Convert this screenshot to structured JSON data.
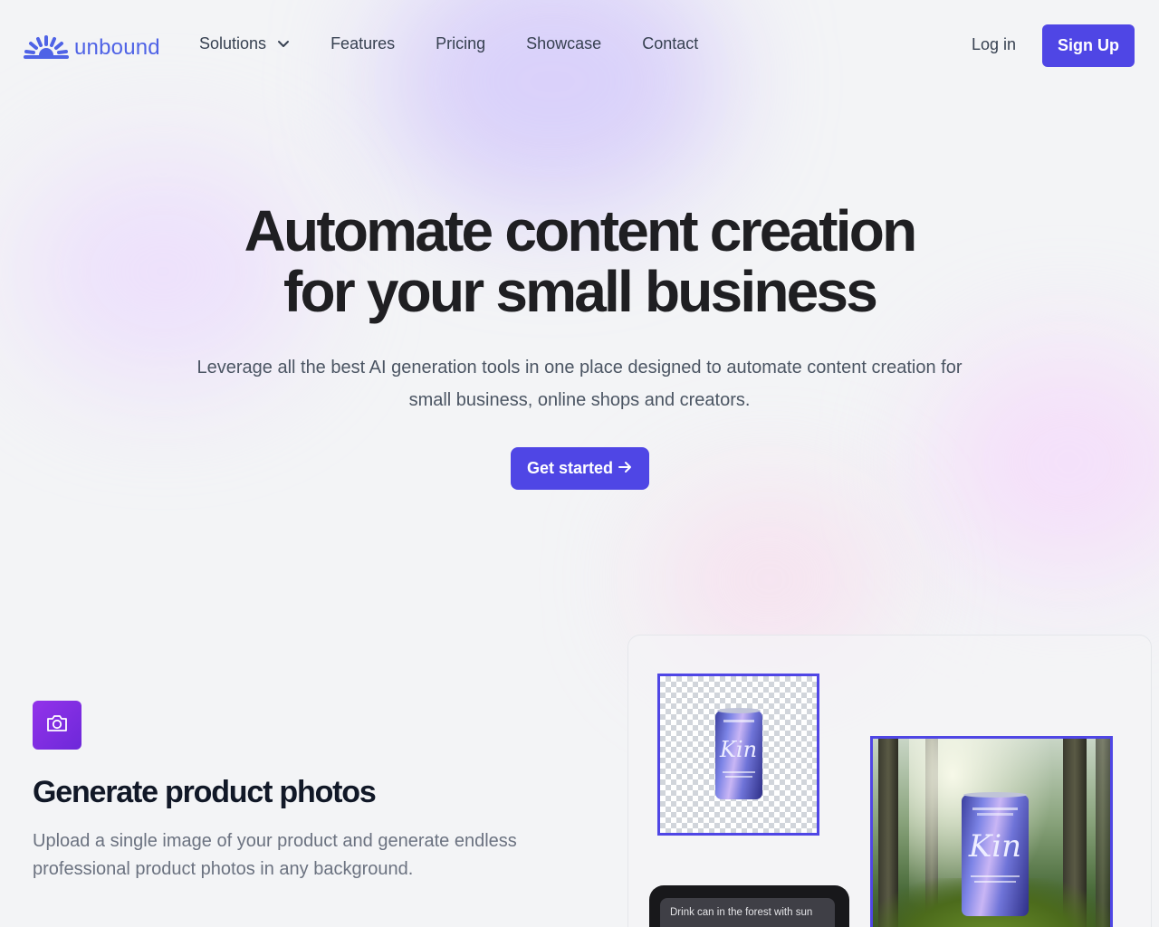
{
  "header": {
    "logo_text": "unbound",
    "nav": [
      {
        "label": "Solutions",
        "has_dropdown": true
      },
      {
        "label": "Features"
      },
      {
        "label": "Pricing"
      },
      {
        "label": "Showcase"
      },
      {
        "label": "Contact"
      }
    ],
    "login_label": "Log in",
    "signup_label": "Sign Up"
  },
  "hero": {
    "title_line1": "Automate content creation",
    "title_line2": "for your small business",
    "subtitle_line1": "Leverage all the best AI generation tools in one place designed to automate content creation for",
    "subtitle_line2": "small business, online shops and creators.",
    "cta_label": "Get started"
  },
  "feature": {
    "icon": "camera-icon",
    "title": "Generate product photos",
    "description_line1": "Upload a single image of your product and generate endless",
    "description_line2": "professional product photos in any background."
  },
  "showcase": {
    "product_brand": "Kin",
    "prompt_text": "Drink can in the forest with sun"
  },
  "colors": {
    "accent": "#4f46e5",
    "logo": "#4f63e6",
    "feature_icon_gradient_from": "#9333ea",
    "feature_icon_gradient_to": "#6d28d9",
    "background": "#f3f4f6"
  }
}
